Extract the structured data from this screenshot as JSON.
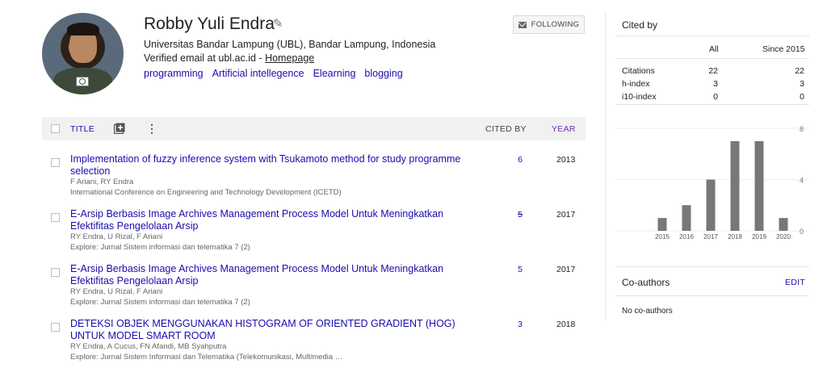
{
  "profile": {
    "name": "Robby Yuli Endra",
    "affiliation": "Universitas Bandar Lampung (UBL), Bandar Lampung, Indonesia",
    "email_text": "Verified email at ubl.ac.id - ",
    "homepage_label": "Homepage",
    "interests": [
      "programming",
      "Artificial intellegence",
      "Elearning",
      "blogging"
    ],
    "follow_label": "FOLLOWING"
  },
  "table": {
    "title_header": "TITLE",
    "cited_header": "CITED BY",
    "year_header": "YEAR",
    "rows": [
      {
        "title": "Implementation of fuzzy inference system with Tsukamoto method for study programme selection",
        "authors": "F Ariani, RY Endra",
        "venue": "International Conference on Engineering and Technology Development (ICETD)",
        "cites": "6",
        "year": "2013"
      },
      {
        "title": "E-Arsip Berbasis Image Archives Management Process Model Untuk Meningkatkan Efektifitas Pengelolaan Arsip",
        "authors": "RY Endra, U Rizal, F Ariani",
        "venue": "Explore: Jurnal Sistem informasi dan telematika 7 (2)",
        "cites": "5",
        "year": "2017"
      },
      {
        "title": "E-Arsip Berbasis Image Archives Management Process Model Untuk Meningkatkan Efektifitas Pengelolaan Arsip",
        "authors": "RY Endra, U Rizal, F Ariani",
        "venue": "Explore: Jurnal Sistem informasi dan telematika 7 (2)",
        "cites": "5",
        "year": "2017"
      },
      {
        "title": "DETEKSI OBJEK MENGGUNAKAN HISTOGRAM OF ORIENTED GRADIENT (HOG) UNTUK MODEL SMART ROOM",
        "authors": "RY Endra, A Cucus, FN Afandi, MB Syahputra",
        "venue": "Explore: Jurnal Sistem Informasi dan Telematika (Telekomunikasi, Multimedia …",
        "cites": "3",
        "year": "2018"
      }
    ]
  },
  "cited_by": {
    "title": "Cited by",
    "col_all": "All",
    "col_since": "Since 2015",
    "metrics": [
      {
        "label": "Citations",
        "all": "22",
        "since": "22"
      },
      {
        "label": "h-index",
        "all": "3",
        "since": "3"
      },
      {
        "label": "i10-index",
        "all": "0",
        "since": "0"
      }
    ]
  },
  "chart_data": {
    "type": "bar",
    "categories": [
      "2015",
      "2016",
      "2017",
      "2018",
      "2019",
      "2020"
    ],
    "values": [
      1,
      2,
      4,
      7,
      7,
      1
    ],
    "ylim": [
      0,
      8
    ],
    "yticks": [
      "8",
      "4",
      "0"
    ],
    "bar_color": "#777777"
  },
  "coauthors": {
    "title": "Co-authors",
    "edit_label": "EDIT",
    "empty_text": "No co-authors"
  }
}
